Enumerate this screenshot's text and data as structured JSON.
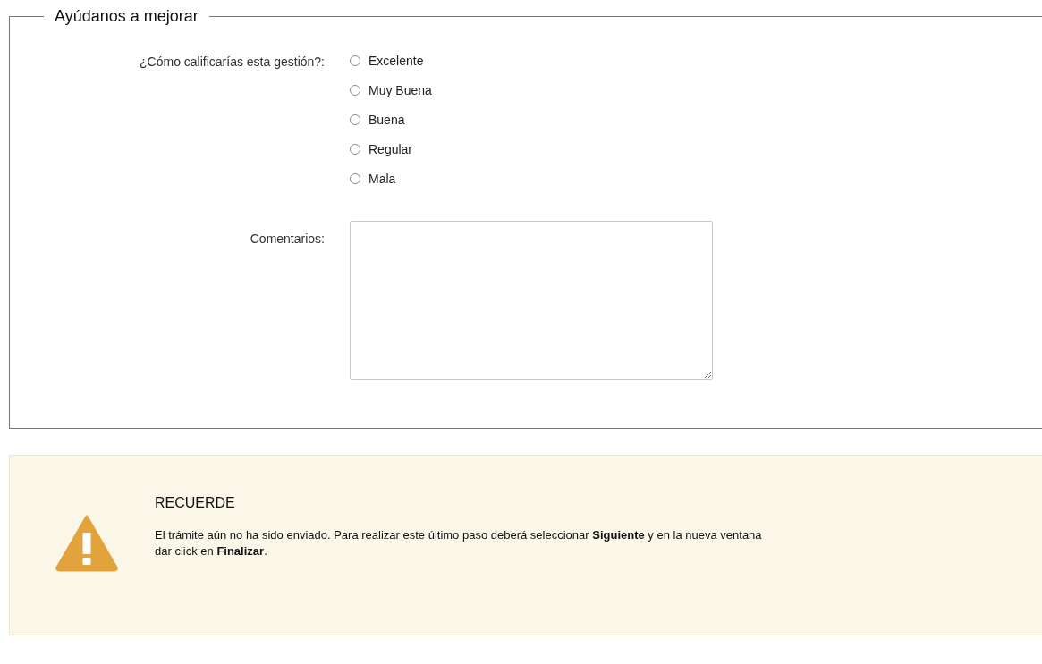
{
  "panel": {
    "legend": "Ayúdanos a mejorar",
    "rating": {
      "label": "¿Cómo calificarías esta gestión?:",
      "options": [
        {
          "label": "Excelente",
          "selected": false
        },
        {
          "label": "Muy Buena",
          "selected": false
        },
        {
          "label": "Buena",
          "selected": false
        },
        {
          "label": "Regular",
          "selected": false
        },
        {
          "label": "Mala",
          "selected": false
        }
      ]
    },
    "comments": {
      "label": "Comentarios:"
    }
  },
  "notice": {
    "title": "RECUERDE",
    "text": "El trámite aún no ha sido enviado. Para realizar este último paso deberá seleccionar **Siguiente** y en la nueva ventana dar click en **Finalizar**."
  }
}
